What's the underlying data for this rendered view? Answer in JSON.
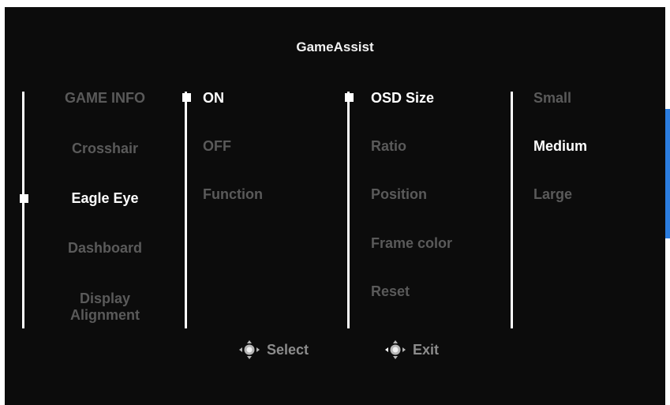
{
  "title": "GameAssist",
  "menu": {
    "items": [
      "GAME INFO",
      "Crosshair",
      "Eagle Eye",
      "Dashboard",
      "Display",
      "Alignment"
    ]
  },
  "col2": {
    "items": [
      "ON",
      "OFF",
      "Function"
    ]
  },
  "col3": {
    "items": [
      "OSD Size",
      "Ratio",
      "Position",
      "Frame color",
      "Reset"
    ]
  },
  "col4": {
    "items": [
      "Small",
      "Medium",
      "Large"
    ]
  },
  "footer": {
    "select_label": "Select",
    "exit_label": "Exit",
    "select_icon": "joystick-icon",
    "exit_icon": "joystick-left-icon"
  },
  "colors": {
    "background": "#0c0c0c",
    "active_text": "#ffffff",
    "inactive_text": "#5a5a5a",
    "scrollbar": "#2b7de0"
  }
}
